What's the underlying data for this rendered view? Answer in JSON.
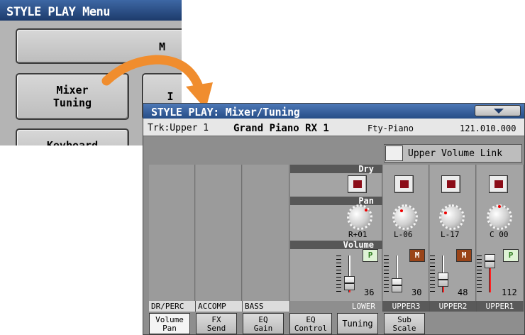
{
  "bg_menu": {
    "title": "STYLE PLAY Menu",
    "buttons": {
      "top": "M",
      "mixer_line1": "Mixer",
      "mixer_line2": "Tuning",
      "right": "I",
      "keyboard": "Keyboard"
    }
  },
  "window": {
    "title": "STYLE PLAY: Mixer/Tuning",
    "track_prefix": "Trk:Upper 1",
    "sound_name": "Grand Piano RX 1",
    "bank": "Fty-Piano",
    "program": "121.010.000",
    "upper_volume_link": "Upper Volume Link"
  },
  "sections": {
    "dry": "Dry",
    "pan": "Pan",
    "volume": "Volume"
  },
  "channels": [
    {
      "name": "DR/PERC",
      "empty": true
    },
    {
      "name": "ACCOMP",
      "empty": true
    },
    {
      "name": "BASS",
      "empty": true
    },
    {
      "name": "LOWER",
      "pan": "R+01",
      "volume": "36",
      "pm": "P",
      "level": 0.28
    },
    {
      "name": "UPPER3",
      "pan": "L-06",
      "volume": "30",
      "pm": "M",
      "level": 0.24
    },
    {
      "name": "UPPER2",
      "pan": "L-17",
      "volume": "48",
      "pm": "M",
      "level": 0.38
    },
    {
      "name": "UPPER1",
      "pan": "C 00",
      "volume": "112",
      "pm": "P",
      "level": 0.88
    }
  ],
  "tabs": [
    {
      "l1": "Volume",
      "l2": "Pan",
      "active": true
    },
    {
      "l1": "FX",
      "l2": "Send"
    },
    {
      "l1": "EQ",
      "l2": "Gain"
    },
    {
      "l1": "EQ",
      "l2": "Control"
    },
    {
      "l1": "Tuning",
      "l2": ""
    },
    {
      "l1": "Sub",
      "l2": "Scale"
    }
  ],
  "colors": {
    "title_bar": "#264d86",
    "dry_on": "#8b0c18",
    "play": "#2c7a1c",
    "mute": "#9a4418"
  }
}
